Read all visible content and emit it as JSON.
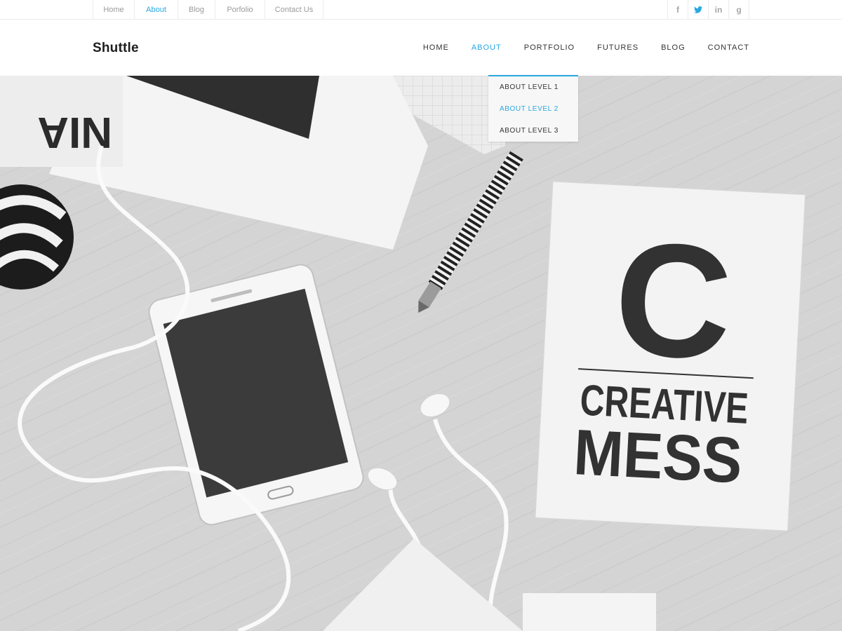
{
  "topbar": {
    "links": [
      "Home",
      "About",
      "Blog",
      "Porfolio",
      "Contact Us"
    ],
    "active_link": "About",
    "social": [
      {
        "icon": "facebook-icon",
        "glyph": "f"
      },
      {
        "icon": "twitter-icon",
        "glyph": "t"
      },
      {
        "icon": "linkedin-icon",
        "glyph": "in"
      },
      {
        "icon": "google-plus-icon",
        "glyph": "g"
      }
    ],
    "active_social": "twitter-icon"
  },
  "header": {
    "logo": "Shuttle",
    "nav": [
      "HOME",
      "ABOUT",
      "PORTFOLIO",
      "FUTURES",
      "BLOG",
      "CONTACT"
    ],
    "active_nav": "ABOUT"
  },
  "dropdown": {
    "items": [
      "ABOUT LEVEL 1",
      "ABOUT LEVEL 2",
      "ABOUT LEVEL 3"
    ],
    "active_item": "ABOUT LEVEL 2"
  },
  "hero": {
    "notebook_letter": "C",
    "notebook_line1": "CREATIVE",
    "notebook_line2": "MESS",
    "paper_text": "NIA"
  },
  "colors": {
    "accent": "#29a8e0",
    "text": "#333333",
    "muted": "#9a9a9a"
  }
}
